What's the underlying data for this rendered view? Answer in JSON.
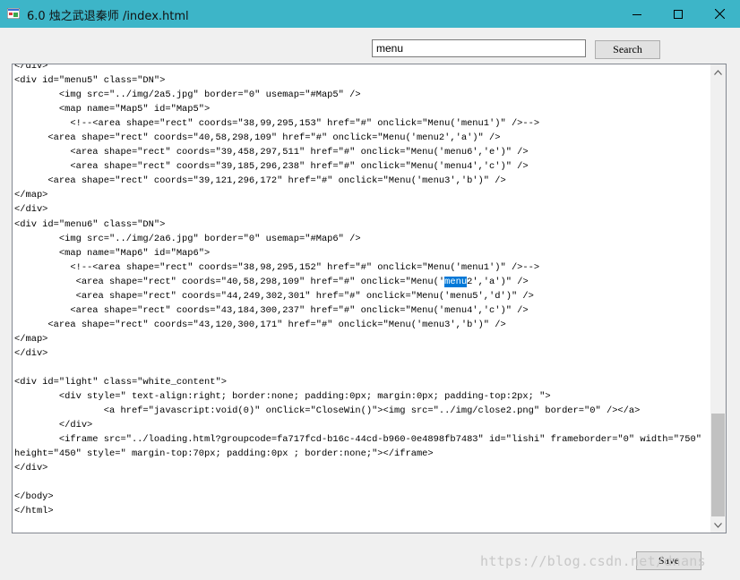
{
  "window": {
    "title": "6.0 烛之武退秦师  /index.html",
    "controls": {
      "minimize_icon": "minimize-icon",
      "maximize_icon": "maximize-icon",
      "close_icon": "close-icon"
    }
  },
  "search": {
    "value": "menu",
    "button_label": "Search"
  },
  "editor": {
    "lines_before": [
      "</div>",
      "<div id=\"menu5\" class=\"DN\">",
      "        <img src=\"../img/2a5.jpg\" border=\"0\" usemap=\"#Map5\" />",
      "        <map name=\"Map5\" id=\"Map5\">",
      "          <!--<area shape=\"rect\" coords=\"38,99,295,153\" href=\"#\" onclick=\"Menu('menu1')\" />-->",
      "      <area shape=\"rect\" coords=\"40,58,298,109\" href=\"#\" onclick=\"Menu('menu2','a')\" />",
      "          <area shape=\"rect\" coords=\"39,458,297,511\" href=\"#\" onclick=\"Menu('menu6','e')\" />",
      "          <area shape=\"rect\" coords=\"39,185,296,238\" href=\"#\" onclick=\"Menu('menu4','c')\" />",
      "      <area shape=\"rect\" coords=\"39,121,296,172\" href=\"#\" onclick=\"Menu('menu3','b')\" />",
      "</map>",
      "</div>",
      "<div id=\"menu6\" class=\"DN\">",
      "        <img src=\"../img/2a6.jpg\" border=\"0\" usemap=\"#Map6\" />",
      "        <map name=\"Map6\" id=\"Map6\">",
      "          <!--<area shape=\"rect\" coords=\"38,98,295,152\" href=\"#\" onclick=\"Menu('menu1')\" />-->"
    ],
    "highlight_line": {
      "prefix": "           <area shape=\"rect\" coords=\"40,58,298,109\" href=\"#\" onclick=\"Menu('",
      "match": "menu",
      "suffix": "2','a')\" />"
    },
    "lines_after": [
      "           <area shape=\"rect\" coords=\"44,249,302,301\" href=\"#\" onclick=\"Menu('menu5','d')\" />",
      "          <area shape=\"rect\" coords=\"43,184,300,237\" href=\"#\" onclick=\"Menu('menu4','c')\" />",
      "      <area shape=\"rect\" coords=\"43,120,300,171\" href=\"#\" onclick=\"Menu('menu3','b')\" />",
      "</map>",
      "</div>",
      "",
      "<div id=\"light\" class=\"white_content\">",
      "        <div style=\" text-align:right; border:none; padding:0px; margin:0px; padding-top:2px; \">",
      "                <a href=\"javascript:void(0)\" onClick=\"CloseWin()\"><img src=\"../img/close2.png\" border=\"0\" /></a>",
      "        </div>",
      "        <iframe src=\"../loading.html?groupcode=fa717fcd-b16c-44cd-b960-0e4898fb7483\" id=\"lishi\" frameborder=\"0\" width=\"750\"",
      "height=\"450\" style=\" margin-top:70px; padding:0px ; border:none;\"></iframe>",
      "</div>",
      "",
      "</body>",
      "</html>"
    ]
  },
  "save_button_label": "Save",
  "watermark": "https://blog.csdn.net/dnans",
  "colors": {
    "titlebar": "#3db5c8",
    "selection": "#0078d7"
  }
}
